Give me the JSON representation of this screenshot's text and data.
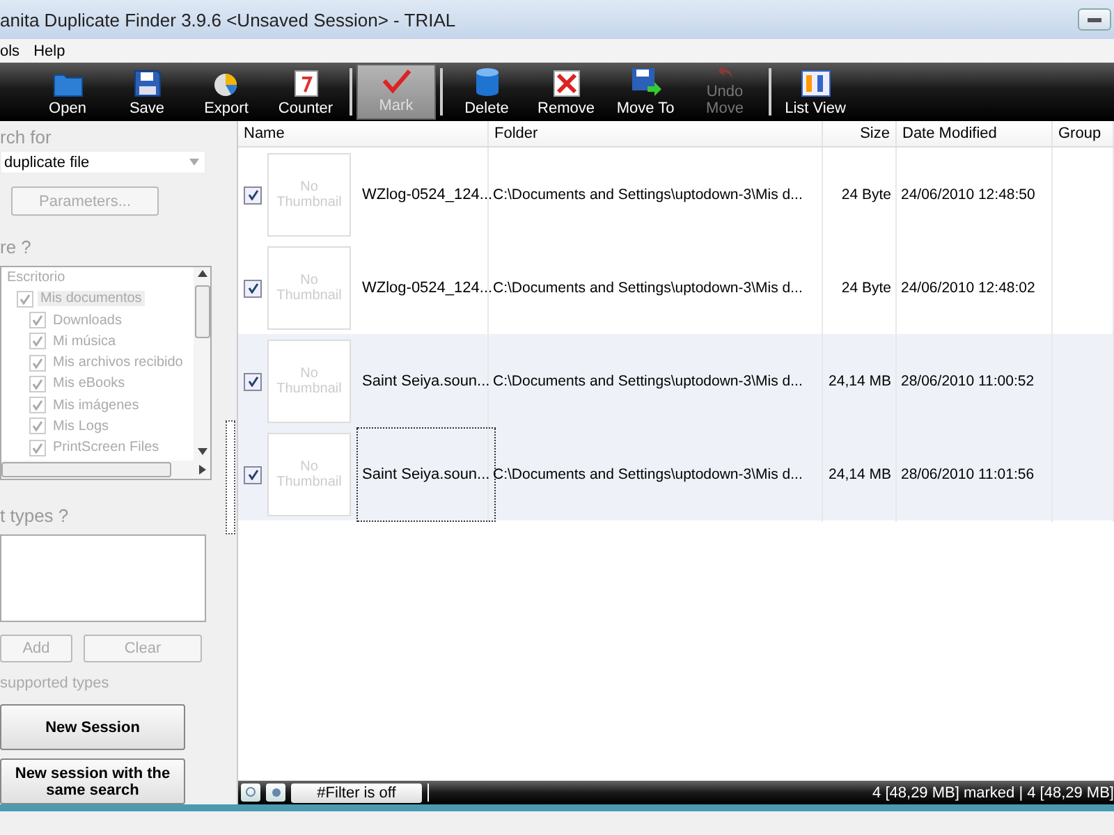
{
  "window": {
    "title": "anita Duplicate Finder 3.9.6 <Unsaved Session> - TRIAL"
  },
  "menu": [
    "ols",
    "Help"
  ],
  "toolbar": [
    {
      "label": "Open",
      "kind": "open",
      "selected": false,
      "disabled": false
    },
    {
      "label": "Save",
      "kind": "save",
      "selected": false,
      "disabled": false
    },
    {
      "label": "Export",
      "kind": "export",
      "selected": false,
      "disabled": false
    },
    {
      "label": "Counter",
      "kind": "counter",
      "selected": false,
      "disabled": false,
      "separator_after": true
    },
    {
      "label": "Mark",
      "kind": "mark",
      "selected": true,
      "disabled": false,
      "separator_after": true
    },
    {
      "label": "Delete",
      "kind": "delete",
      "selected": false,
      "disabled": false
    },
    {
      "label": "Remove",
      "kind": "remove",
      "selected": false,
      "disabled": false
    },
    {
      "label": "Move To",
      "kind": "move",
      "selected": false,
      "disabled": false
    },
    {
      "label": "Undo Move",
      "kind": "undo",
      "selected": false,
      "disabled": true,
      "separator_after": true
    },
    {
      "label": "List View",
      "kind": "listview",
      "selected": false,
      "disabled": false
    }
  ],
  "left_panel": {
    "search_heading": "rch for",
    "search_type": "duplicate file",
    "parameters_button": "Parameters...",
    "where_heading": "re ?",
    "tree": [
      {
        "label": "Escritorio",
        "children": [
          {
            "label": "Mis documentos",
            "checked": true,
            "selected": true,
            "children": [
              {
                "label": "Downloads",
                "checked": true,
                "selected": false
              },
              {
                "label": "Mi música",
                "checked": true,
                "selected": false
              },
              {
                "label": "Mis archivos recibido",
                "checked": true,
                "selected": false
              },
              {
                "label": "Mis eBooks",
                "checked": true,
                "selected": false
              },
              {
                "label": "Mis imágenes",
                "checked": true,
                "selected": false
              },
              {
                "label": "Mis Logs",
                "checked": true,
                "selected": false
              },
              {
                "label": "PrintScreen Files",
                "checked": true,
                "selected": false
              }
            ]
          }
        ]
      }
    ],
    "types_heading": "t types ?",
    "add_button": "Add",
    "clear_button": "Clear",
    "types_note": "supported types",
    "new_session_button": "New Session",
    "same_search_button": "New session with the same search"
  },
  "table": {
    "columns": [
      "Name",
      "Folder",
      "Size",
      "Date Modified",
      "Group"
    ],
    "rows": [
      {
        "checked": true,
        "thumbnail": "No Thumbnail",
        "name": "WZlog-0524_124...",
        "folder": "C:\\Documents and Settings\\uptodown-3\\Mis d...",
        "size": "24 Byte",
        "date": "24/06/2010 12:48:50",
        "shaded": false,
        "focused": false
      },
      {
        "checked": true,
        "thumbnail": "No Thumbnail",
        "name": "WZlog-0524_124...",
        "folder": "C:\\Documents and Settings\\uptodown-3\\Mis d...",
        "size": "24 Byte",
        "date": "24/06/2010 12:48:02",
        "shaded": false,
        "focused": false
      },
      {
        "checked": true,
        "thumbnail": "No Thumbnail",
        "name": "Saint Seiya.soun...",
        "folder": "C:\\Documents and Settings\\uptodown-3\\Mis d...",
        "size": "24,14 MB",
        "date": "28/06/2010 11:00:52",
        "shaded": true,
        "focused": false
      },
      {
        "checked": true,
        "thumbnail": "No Thumbnail",
        "name": "Saint Seiya.soun...",
        "folder": "C:\\Documents and Settings\\uptodown-3\\Mis d...",
        "size": "24,14 MB",
        "date": "28/06/2010 11:01:56",
        "shaded": true,
        "focused": true
      }
    ]
  },
  "status_bar": {
    "filter": "#Filter is off",
    "summary": "4 [48,29 MB] marked  |  4 [48,29 MB]"
  }
}
